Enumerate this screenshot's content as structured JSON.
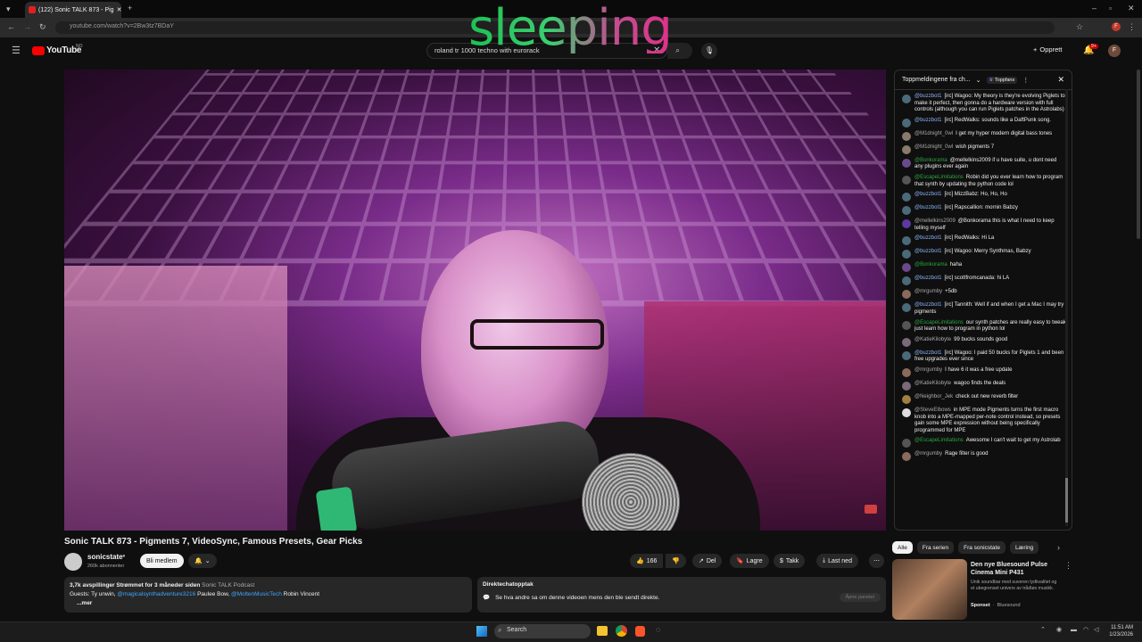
{
  "browser": {
    "tab_title": "(122) Sonic TALK 873 - Pig",
    "url": "youtube.com/watch?v=2Bw3tz7BDaY",
    "profile_initial": "F"
  },
  "overlay_text": "sleeping",
  "header": {
    "logo": "YouTube",
    "logo_region": "NO",
    "search_value": "roland tr 1000 techno with eurorack",
    "create_label": "Opprett",
    "notif_count": "9+",
    "avatar_initial": "F"
  },
  "video": {
    "title": "Sonic TALK 873 - Pigments 7, VideoSync, Famous Presets, Gear Picks",
    "channel": "sonicstate",
    "subscribers": "260k abonnenter",
    "join_label": "Bli medlem",
    "likes": "166",
    "share_label": "Del",
    "save_label": "Lagre",
    "thanks_label": "Takk",
    "download_label": "Last ned"
  },
  "description": {
    "stats": "3,7k avspillinger",
    "streamed": "Strømmet for 3 måneder siden",
    "podcast": "Sonic TALK Podcast",
    "guests_prefix": "Guests: Ty unwin,",
    "guest_link1": "@magicalsynthadventure3216",
    "guest_mid": "Paulee Bow,",
    "guest_link2": "@MoltenMusicTech",
    "guest_last": "Robin Vincent",
    "more": "...mer"
  },
  "chat_replay": {
    "title": "Direktechatopptak",
    "text": "Se hva andre sa om denne videoen mens den ble sendt direkte.",
    "button": "Åpne panelet"
  },
  "chat": {
    "header_title": "Toppmeldingene fra ch...",
    "top_fans": "Toppfans",
    "messages": [
      {
        "author": "@buzzbot1",
        "text": "[irc] Wagoo: My theory is they're evolving Piglets to make it perfect, then gonna do a hardware version with full controls (although you can run Piglets patches in the Astrolabs)",
        "color": "#4a6a7a"
      },
      {
        "author": "@buzzbot1",
        "text": "[irc] RedWalks: sounds like a DaftPunk song.",
        "color": "#4a6a7a"
      },
      {
        "author": "@M1dnight_0wl",
        "text": "I get my hyper modern digital bass tones",
        "color": "#8a7a6a"
      },
      {
        "author": "@M1dnight_0wl",
        "text": "wish pigments 7",
        "color": "#8a7a6a"
      },
      {
        "author": "@Bonkorama",
        "text": "@mellelkins2009 if u have suite, u dont need any plugins ever again",
        "color": "#6a4a8a"
      },
      {
        "author": "@EscapeLimitations",
        "text": "Robin did you ever learn how to program that synth by updating the python code lol",
        "color": "#555555"
      },
      {
        "author": "@buzzbot1",
        "text": "[irc] MizzBabz: Ho, Ho, Ho",
        "color": "#4a6a7a"
      },
      {
        "author": "@buzzbot1",
        "text": "[irc] Rapscallion: mornin Babzy",
        "color": "#4a6a7a"
      },
      {
        "author": "@mellelkins2009",
        "text": "@Bonkorama this is what I need to keep telling myself",
        "color": "#5a3aa0"
      },
      {
        "author": "@buzzbot1",
        "text": "[irc] RedWalks: Hi La",
        "color": "#4a6a7a"
      },
      {
        "author": "@buzzbot1",
        "text": "[irc] Wagoo: Merry Synthmas, Babzy",
        "color": "#4a6a7a"
      },
      {
        "author": "@Bonkorama",
        "text": "haha",
        "color": "#6a4a8a"
      },
      {
        "author": "@buzzbot1",
        "text": "[irc] scottfromcanada: hi LA",
        "color": "#4a6a7a"
      },
      {
        "author": "@mrgumby",
        "text": "+5db",
        "color": "#8a6a5a"
      },
      {
        "author": "@buzzbot1",
        "text": "[irc] Tannith: Well if and when I get a Mac I may try pigments",
        "color": "#4a6a7a"
      },
      {
        "author": "@EscapeLimitations",
        "text": "our synth patches are really easy to tweak just learn how to program in python lol",
        "color": "#555555"
      },
      {
        "author": "@KatieKilobyte",
        "text": "99 bucks sounds good",
        "color": "#7a6a7a"
      },
      {
        "author": "@buzzbot1",
        "text": "[irc] Wagoo: I paid 50 bucks for Piglets 1 and been free upgrades ever since",
        "color": "#4a6a7a"
      },
      {
        "author": "@mrgumby",
        "text": "I have 6 it was a free update",
        "color": "#8a6a5a"
      },
      {
        "author": "@KatieKilobyte",
        "text": "wagoo finds the deals",
        "color": "#7a6a7a"
      },
      {
        "author": "@Neighbor_Jek",
        "text": "check out new reverb filter",
        "color": "#a08040"
      },
      {
        "author": "@SteveElbows",
        "text": "in MPE mode Pigments turns the first macro knob into a MPE-mapped per-note control instead, so presets gain some MPE expression without being specifically programmed for MPE",
        "color": "#dddddd"
      },
      {
        "author": "@EscapeLimitations",
        "text": "Awesome I can't wait to get my Astrolab",
        "color": "#555555"
      },
      {
        "author": "@mrgumby",
        "text": "Rage filter is good",
        "color": "#8a6a5a"
      }
    ]
  },
  "recs": {
    "chips": [
      "Alle",
      "Fra serien",
      "Fra sonicstate",
      "Læring"
    ],
    "item_title": "Den nye Bluesound Pulse Cinema Mini P431",
    "item_desc": "Unik soundbar med suveren lydkvalitet og et ubegrenset univers av trådløs musikk.",
    "item_sponsor": "Sponset",
    "item_brand": "Bluesound"
  },
  "taskbar": {
    "search_label": "Search",
    "time": "11:51 AM",
    "date": "1/23/2026"
  }
}
